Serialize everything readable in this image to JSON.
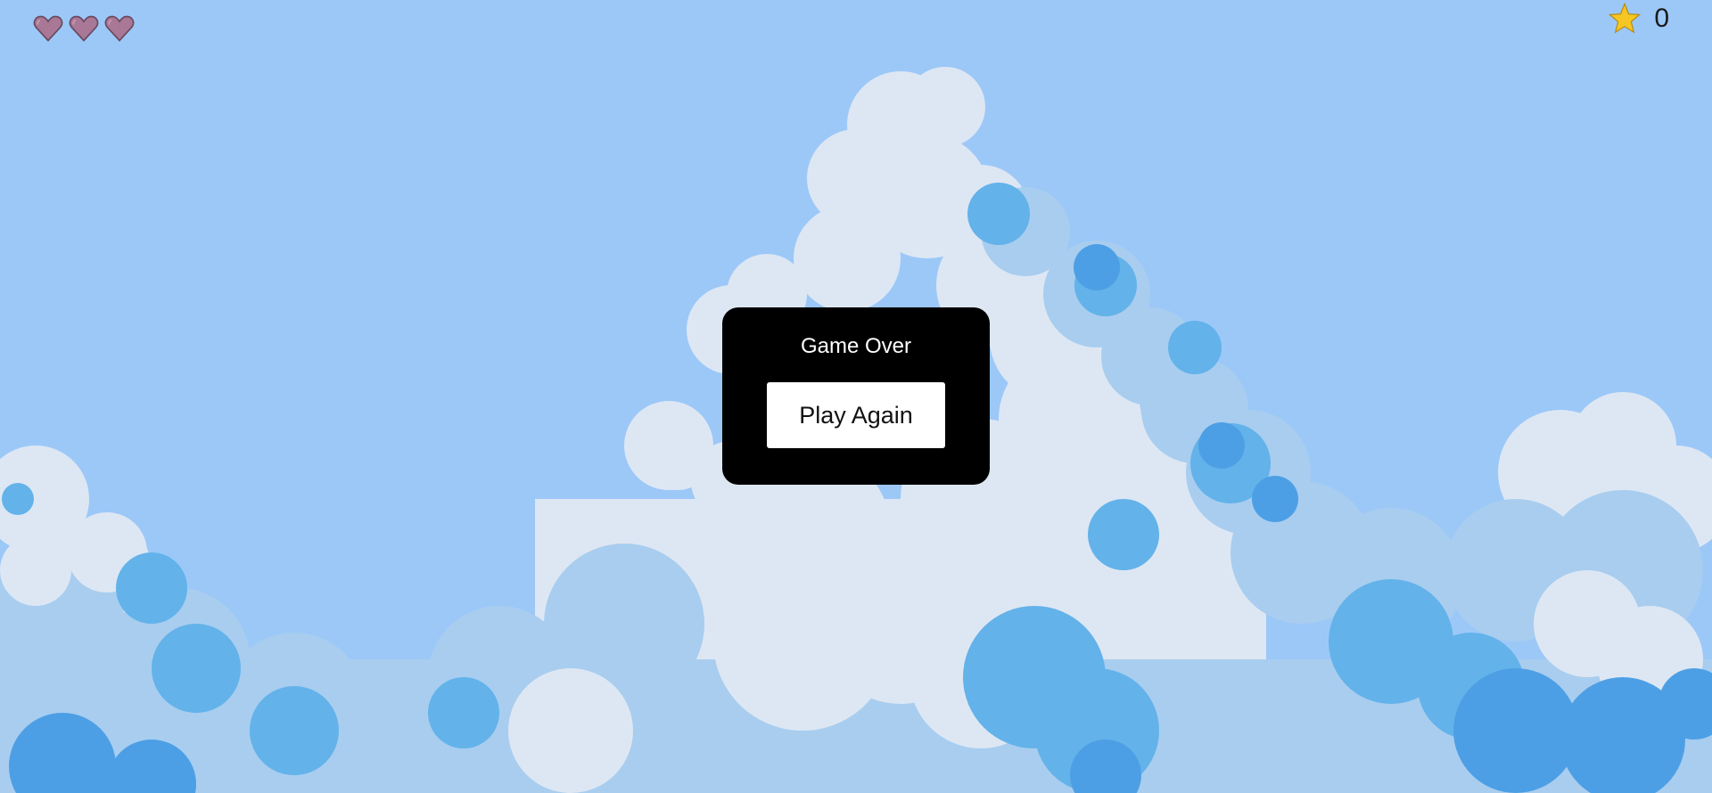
{
  "hud": {
    "lives": [
      {
        "icon": "heart-icon",
        "state": "lost"
      },
      {
        "icon": "heart-icon",
        "state": "lost"
      },
      {
        "icon": "heart-icon",
        "state": "lost"
      }
    ],
    "score_icon": "star-icon",
    "score": "0"
  },
  "modal": {
    "title": "Game Over",
    "button_label": "Play Again"
  },
  "colors": {
    "sky": "#9cc8f8",
    "cloud_light": "#dde7f3",
    "cloud_mid": "#a8cdef",
    "cloud_blue": "#63b2ea",
    "cloud_deep": "#4d9fe5",
    "heart_lost": "#a87896",
    "star": "#f6c623",
    "modal_bg": "#000000",
    "button_bg": "#ffffff"
  }
}
